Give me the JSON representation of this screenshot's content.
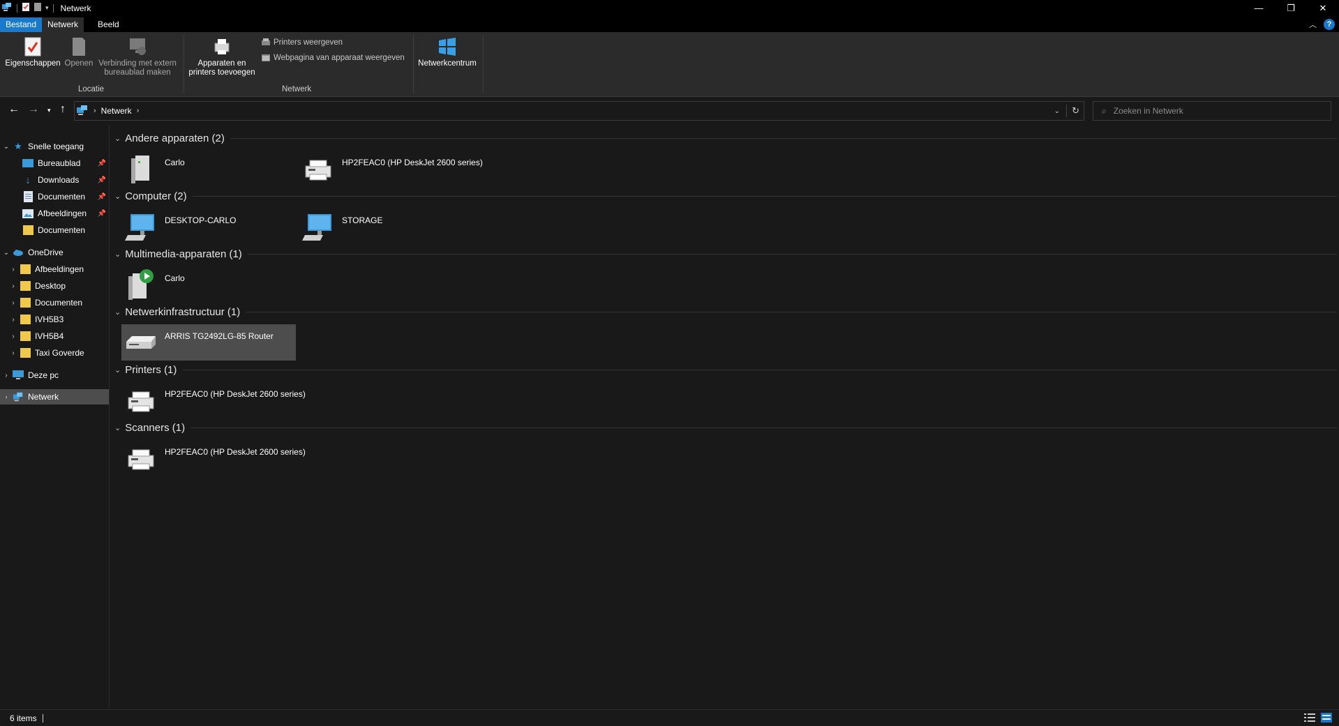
{
  "window": {
    "title": "Netwerk",
    "minimize": "—",
    "restore": "❐",
    "close": "✕"
  },
  "ribbon_tabs": [
    "Bestand",
    "Netwerk",
    "Beeld"
  ],
  "ribbon": {
    "buttons": {
      "properties": "Eigenschappen",
      "open": "Openen",
      "remote_line1": "Verbinding met extern",
      "remote_line2": "bureaublad maken",
      "add_devices_line1": "Apparaten en",
      "add_devices_line2": "printers toevoegen",
      "view_printers": "Printers weergeven",
      "device_webpage": "Webpagina van apparaat weergeven",
      "network_center": "Netwerkcentrum"
    },
    "groups": {
      "location": "Locatie",
      "network": "Netwerk"
    }
  },
  "address": {
    "crumbs": [
      "Netwerk"
    ],
    "search_placeholder": "Zoeken in Netwerk"
  },
  "sidebar": {
    "quick_access": "Snelle toegang",
    "quick_items": [
      "Bureaublad",
      "Downloads",
      "Documenten",
      "Afbeeldingen",
      "Documenten"
    ],
    "onedrive": "OneDrive",
    "onedrive_items": [
      "Afbeeldingen",
      "Desktop",
      "Documenten",
      "IVH5B3",
      "IVH5B4",
      "Taxi Goverde"
    ],
    "this_pc": "Deze pc",
    "network": "Netwerk"
  },
  "groups": [
    {
      "title": "Andere apparaten (2)",
      "items": [
        "Carlo",
        "HP2FEAC0 (HP DeskJet 2600 series)"
      ]
    },
    {
      "title": "Computer (2)",
      "items": [
        "DESKTOP-CARLO",
        "STORAGE"
      ]
    },
    {
      "title": "Multimedia-apparaten (1)",
      "items": [
        "Carlo"
      ]
    },
    {
      "title": "Netwerkinfrastructuur (1)",
      "items": [
        "ARRIS TG2492LG-85 Router"
      ]
    },
    {
      "title": "Printers (1)",
      "items": [
        "HP2FEAC0 (HP DeskJet 2600 series)"
      ]
    },
    {
      "title": "Scanners (1)",
      "items": [
        "HP2FEAC0 (HP DeskJet 2600 series)"
      ]
    }
  ],
  "status": {
    "count": "6 items"
  },
  "colors": {
    "accent": "#1979ca",
    "background": "#191919",
    "ribbon": "#2b2b2b",
    "selection": "#4d4d4d"
  }
}
